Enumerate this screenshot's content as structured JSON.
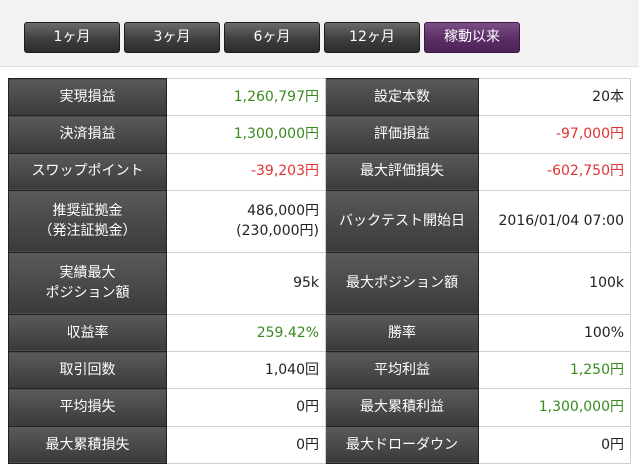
{
  "tabs": [
    {
      "label": "1ヶ月",
      "active": false
    },
    {
      "label": "3ヶ月",
      "active": false
    },
    {
      "label": "6ヶ月",
      "active": false
    },
    {
      "label": "12ヶ月",
      "active": false
    },
    {
      "label": "稼動以来",
      "active": true
    }
  ],
  "colors": {
    "positive": "#3a8a1e",
    "negative": "#e23333",
    "header_bg": "#3a3a3a",
    "active_tab": "#5b2e66"
  },
  "stats": {
    "realized_pl": {
      "label": "実現損益",
      "value": "1,260,797円"
    },
    "settled_pl": {
      "label": "決済損益",
      "value": "1,300,000円"
    },
    "swap_points": {
      "label": "スワップポイント",
      "value": "-39,203円"
    },
    "recommended_margin": {
      "label_line1": "推奨証拠金",
      "label_line2": "（発注証拠金）",
      "value_line1": "486,000円",
      "value_line2": "(230,000円)"
    },
    "max_position_actual": {
      "label_line1": "実績最大",
      "label_line2": "ポジション額",
      "value": "95k"
    },
    "return_rate": {
      "label": "収益率",
      "value": "259.42%"
    },
    "trade_count": {
      "label": "取引回数",
      "value": "1,040回"
    },
    "avg_loss": {
      "label": "平均損失",
      "value": "0円"
    },
    "max_cum_loss": {
      "label": "最大累積損失",
      "value": "0円"
    },
    "order_units": {
      "label": "設定本数",
      "value": "20本"
    },
    "unrealized_pl": {
      "label": "評価損益",
      "value": "-97,000円"
    },
    "max_unrealized_loss": {
      "label": "最大評価損失",
      "value": "-602,750円"
    },
    "backtest_start": {
      "label": "バックテスト開始日",
      "value": "2016/01/04 07:00"
    },
    "max_position": {
      "label": "最大ポジション額",
      "value": "100k"
    },
    "win_rate": {
      "label": "勝率",
      "value": "100%"
    },
    "avg_profit": {
      "label": "平均利益",
      "value": "1,250円"
    },
    "max_cum_profit": {
      "label": "最大累積利益",
      "value": "1,300,000円"
    },
    "max_drawdown": {
      "label": "最大ドローダウン",
      "value": "0円"
    }
  }
}
